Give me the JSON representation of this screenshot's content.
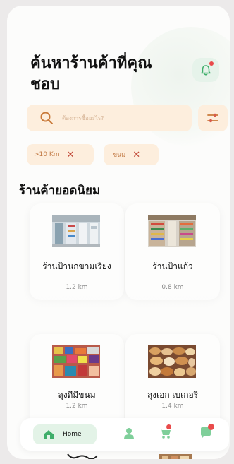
{
  "header": {
    "title": "ค้นหาร้านค้าที่คุณชอบ",
    "notification_icon": "bell-icon"
  },
  "search": {
    "placeholder": "ต้องการซื้ออะไร?",
    "icon": "search-icon",
    "filter_icon": "sliders-icon"
  },
  "filters": [
    {
      "label": ">10 Km",
      "remove": "✕"
    },
    {
      "label": "ขนม",
      "remove": "✕"
    }
  ],
  "section": {
    "title": "ร้านค้ายอดนิยม"
  },
  "shops": [
    {
      "name": "ร้านป้านกขามเรียง",
      "distance": "1.2 km"
    },
    {
      "name": "ร้านป้าแก้ว",
      "distance": "0.8 km"
    },
    {
      "name": "ลุงดีมีขนม",
      "distance": "1.2 km"
    },
    {
      "name": "ลุงเอก เบเกอรี่",
      "distance": "1.4 km"
    }
  ],
  "nav": {
    "home_label": "Home",
    "items": [
      "home-icon",
      "user-icon",
      "cart-icon",
      "chat-icon"
    ]
  },
  "colors": {
    "accent": "#3fae6a",
    "peach": "#fdeedd",
    "badge": "#e94b4b"
  }
}
